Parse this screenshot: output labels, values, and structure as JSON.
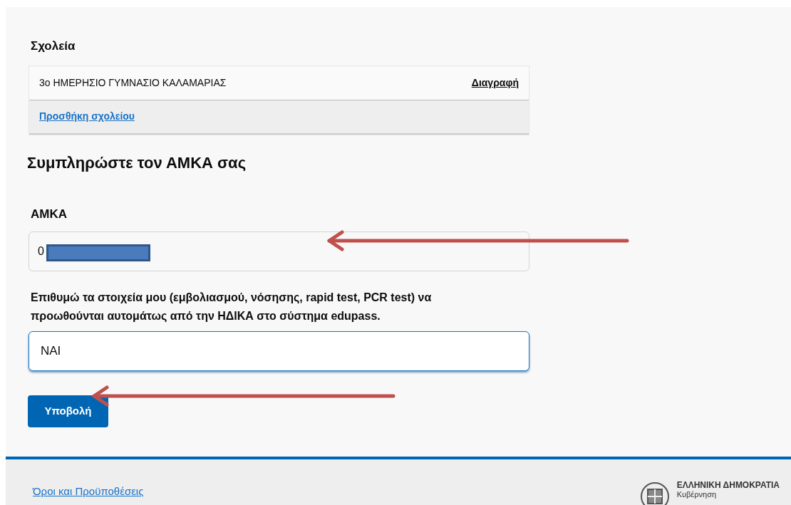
{
  "schools_section": {
    "title": "Σχολεία",
    "schools": [
      {
        "name": "3ο ΗΜΕΡΗΣΙΟ ΓΥΜΝΑΣΙΟ ΚΑΛΑΜΑΡΙΑΣ",
        "action": "Διαγραφή"
      }
    ],
    "add_link": "Προσθήκη σχολείου"
  },
  "amka_section": {
    "heading": "Συμπληρώστε τον ΑΜΚΑ σας",
    "label": "ΑΜΚΑ",
    "value": "0",
    "redacted": true
  },
  "consent": {
    "label": "Επιθυμώ τα στοιχεία μου (εμβολιασμού, νόσησης, rapid test, PCR test) να προωθούνται αυτομάτως από την ΗΔΙΚΑ στο σύστημα edupass.",
    "value": "ΝΑΙ",
    "focused": true
  },
  "submit": "Υποβολή",
  "annotations": [
    {
      "kind": "arrow"
    },
    {
      "kind": "arrow"
    }
  ],
  "footer": {
    "link": "Όροι και Προϋποθέσεις",
    "logo_title": "ΕΛΛΗΝΙΚΗ ΔΗΜΟΚΡΑΤΙΑ",
    "logo_subtitle": "Κυβέρνηση"
  }
}
